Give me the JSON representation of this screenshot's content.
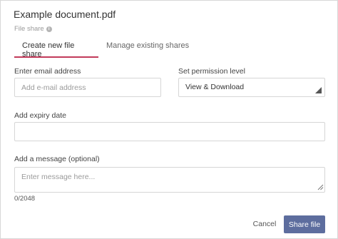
{
  "dialog": {
    "title": "Example document.pdf",
    "subtitle": "File share",
    "info_glyph": "i"
  },
  "tabs": [
    {
      "label": "Create new file share",
      "active": true
    },
    {
      "label": "Manage existing shares",
      "active": false
    }
  ],
  "form": {
    "email": {
      "label": "Enter email address",
      "placeholder": "Add e-mail address",
      "value": ""
    },
    "permission": {
      "label": "Set permission level",
      "value": "View & Download"
    },
    "expiry": {
      "label": "Add expiry date",
      "value": ""
    },
    "message": {
      "label": "Add a message (optional)",
      "placeholder": "Enter message here...",
      "value": "",
      "counter": "0/2048"
    }
  },
  "actions": {
    "cancel_label": "Cancel",
    "share_label": "Share file"
  },
  "colors": {
    "accent": "#c23a5a",
    "primary_button": "#5d6d9e"
  }
}
